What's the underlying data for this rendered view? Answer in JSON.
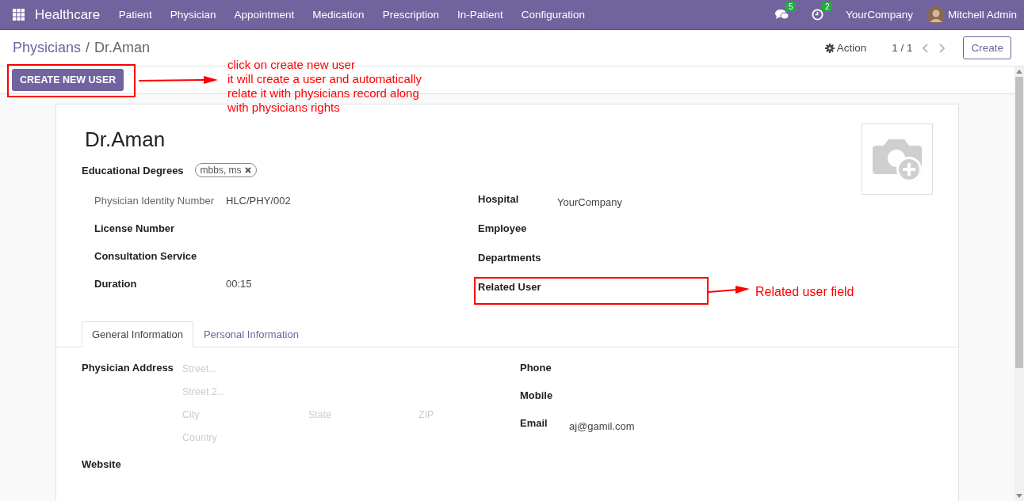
{
  "navbar": {
    "app_name": "Healthcare",
    "menu": [
      "Patient",
      "Physician",
      "Appointment",
      "Medication",
      "Prescription",
      "In-Patient",
      "Configuration"
    ],
    "messages_count": "5",
    "activities_count": "2",
    "company": "YourCompany",
    "user": "Mitchell Admin"
  },
  "breadcrumb": {
    "parent": "Physicians",
    "separator": "/",
    "current": "Dr.Aman"
  },
  "control_panel": {
    "action": "Action",
    "pager": "1 / 1",
    "create": "Create"
  },
  "statusbar": {
    "button": "CREATE NEW USER"
  },
  "record": {
    "name": "Dr.Aman",
    "degrees_label": "Educational Degrees",
    "degrees": [
      {
        "label": "mbbs, ms"
      }
    ],
    "left_fields": [
      {
        "label": "Physician Identity Number",
        "value": "HLC/PHY/002",
        "muted": true
      },
      {
        "label": "License Number",
        "muted": false
      },
      {
        "label": "Consultation Service",
        "muted": false
      },
      {
        "label": "Duration",
        "value": "00:15",
        "muted": false
      }
    ],
    "right_fields": [
      {
        "label": "Hospital",
        "value": "YourCompany"
      },
      {
        "label": "Employee"
      },
      {
        "label": "Departments"
      },
      {
        "label": "Related User"
      }
    ]
  },
  "tabs": [
    {
      "label": "General Information",
      "selected": true
    },
    {
      "label": "Personal Information",
      "selected": false
    }
  ],
  "general": {
    "address_label": "Physician Address",
    "address": {
      "street": {
        "placeholder": "Street..."
      },
      "street2": {
        "placeholder": "Street 2..."
      },
      "city": {
        "placeholder": "City"
      },
      "state": {
        "placeholder": "State"
      },
      "zip": {
        "placeholder": "ZIP"
      },
      "country": {
        "placeholder": "Country"
      }
    },
    "website_label": "Website",
    "contact_fields": [
      {
        "label": "Phone"
      },
      {
        "label": "Mobile"
      },
      {
        "label": "Email",
        "value": "aj@gamil.com"
      }
    ]
  },
  "annotations": [
    {
      "kind": "callout",
      "lines": [
        "click on create new user",
        "it will create a user and automatically",
        "relate it with physicians record along",
        "with physicians rights"
      ]
    },
    {
      "kind": "field",
      "lines": [
        "Related user field"
      ]
    }
  ]
}
